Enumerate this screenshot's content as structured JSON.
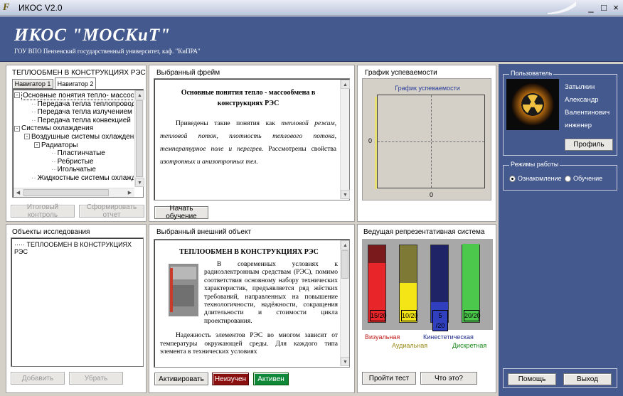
{
  "window": {
    "title": "ИКОС V2.0",
    "logo": "F",
    "controls": [
      "_",
      "□",
      "×"
    ]
  },
  "banner": {
    "title": "ИКОС \"МОСКиТ\"",
    "subtitle": "ГОУ ВПО Пензенский государственный университет, каф. \"КиПРА\""
  },
  "nav": {
    "title": "ТЕПЛООБМЕН В КОНСТРУКЦИЯХ РЭС",
    "tabs": [
      "Навигатор 1",
      "Навигатор 2"
    ],
    "tree": [
      {
        "t": "Основные понятия тепло- массообме",
        "lvl": 0,
        "box": "-"
      },
      {
        "t": "Передача тепла теплопроводност",
        "lvl": 1
      },
      {
        "t": "Передача тепла излучением",
        "lvl": 1
      },
      {
        "t": "Передача тепла конвекцией",
        "lvl": 1
      },
      {
        "t": "Системы охлаждения",
        "lvl": 0,
        "box": "-"
      },
      {
        "t": "Воздушные системы охлаждения",
        "lvl": 1,
        "box": "-"
      },
      {
        "t": "Радиаторы",
        "lvl": 2,
        "box": "-"
      },
      {
        "t": "Пластинчатые",
        "lvl": 3
      },
      {
        "t": "Ребристые",
        "lvl": 3
      },
      {
        "t": "Игольчатые",
        "lvl": 3
      },
      {
        "t": "Жидкостные системы охлаждени",
        "lvl": 1
      }
    ],
    "btn_final": "Итоговый контроль",
    "btn_report": "Сформировать отчет"
  },
  "objects": {
    "title": "Объекты исследования",
    "item": "ТЕПЛООБМЕН В КОНСТРУКЦИЯХ РЭС",
    "btn_add": "Добавить",
    "btn_remove": "Убрать"
  },
  "frame": {
    "title": "Выбранный фрейм",
    "heading": "Основные понятия тепло - массообмена в конструкциях РЭС",
    "p1": "Приведены такие понятия как",
    "p1i": "тепловой режим, тепловой поток, плотность теплового потока, температурное поле и перегрев.",
    "p1b": "Рассмотрены свойства",
    "p1i2": "изотропных и анизотропных тел.",
    "btn_start": "Начать обучение"
  },
  "external": {
    "title": "Выбранный внешний объект",
    "heading": "ТЕПЛООБМЕН В КОНСТРУКЦИЯХ РЭС",
    "p1": "В современных условиях к радиоэлектронным средствам (РЭС), помимо соответствия основному набору технических характеристик, предъявляется ряд жёстких требований, направленных на повышение технологичности, надёжности, сокращения длительности и стоимости цикла проектирования.",
    "p2": "Надежность элементов РЭС во многом зависит от температуры окружающей среды. Для каждого типа элемента в технических условиях",
    "btn_activate": "Активировать",
    "btn_inactive": "Неизучен",
    "btn_active": "Активен"
  },
  "progress": {
    "title": "График успеваемости",
    "chart_title": "График успеваемости",
    "ylabel": "0",
    "xlabel": "0"
  },
  "chart_data": {
    "type": "bar",
    "title": "Ведущая репрезентативная система",
    "categories": [
      "Визуальная",
      "Аудиальная",
      "Кинестетическая",
      "Дискретная"
    ],
    "values": [
      15,
      10,
      5,
      20
    ],
    "max": 20,
    "labels": [
      "15/20",
      "10/20",
      "5 /20",
      "20/20"
    ],
    "colors_fill": [
      "#e8262a",
      "#f4e616",
      "#2f3fbe",
      "#4cc84c"
    ],
    "colors_empty": [
      "#7a1a1c",
      "#7e7a36",
      "#1e2466",
      "#4cc84c"
    ],
    "label_colors": [
      "#c01818",
      "#9a8a18",
      "#1e2a8a",
      "#18881a"
    ]
  },
  "rep_buttons": {
    "test": "Пройти тест",
    "what": "Что это?"
  },
  "user": {
    "group": "Пользователь",
    "first": "Затылкин",
    "name": "Александр",
    "patronymic": "Валентинович",
    "role": "инженер",
    "btn_profile": "Профиль"
  },
  "modes": {
    "group": "Режимы работы",
    "opt1": "Ознакомление",
    "opt2": "Обучение"
  },
  "footer": {
    "help": "Помощь",
    "exit": "Выход"
  }
}
